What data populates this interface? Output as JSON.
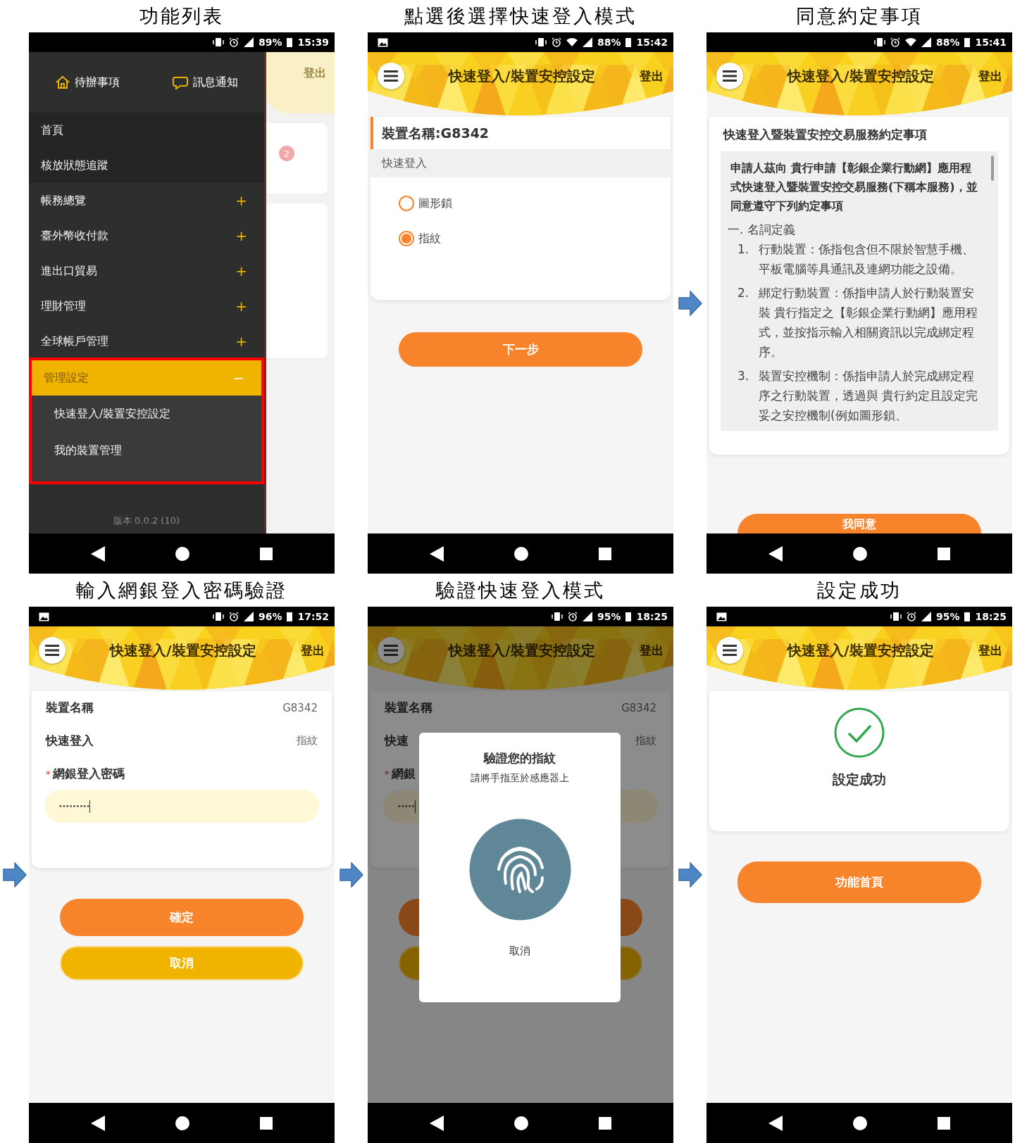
{
  "screens": [
    {
      "kind": "menu",
      "caption": "功能列表",
      "status_bar": {
        "image_icon": false,
        "wifi": false,
        "battery": "89%",
        "time": "15:39"
      },
      "shortcuts": [
        {
          "label": "待辦事項"
        },
        {
          "label": "訊息通知"
        }
      ],
      "items": [
        {
          "label": "首頁",
          "expanded": false,
          "highlighted": false
        },
        {
          "label": "核放狀態追蹤",
          "expanded": false,
          "highlighted": false
        },
        {
          "label": "帳務總覽",
          "toggle": "+",
          "expanded": false,
          "highlighted": false
        },
        {
          "label": "臺外幣收付款",
          "toggle": "+",
          "expanded": false,
          "highlighted": false
        },
        {
          "label": "進出口貿易",
          "toggle": "+",
          "expanded": false,
          "highlighted": false
        },
        {
          "label": "理財管理",
          "toggle": "+",
          "expanded": false,
          "highlighted": false
        },
        {
          "label": "全球帳戶管理",
          "toggle": "+",
          "expanded": false,
          "highlighted": false
        },
        {
          "label": "管理設定",
          "toggle": "−",
          "expanded": true,
          "highlighted": true,
          "children": [
            {
              "label": "快速登入/裝置安控設定"
            },
            {
              "label": "我的裝置管理"
            }
          ]
        }
      ],
      "version": "版本 0.0.2 (10)",
      "behind": {
        "logout": "登出",
        "badge": "2"
      }
    },
    {
      "kind": "options",
      "caption": "點選後選擇快速登入模式",
      "status_bar": {
        "image_icon": true,
        "wifi": true,
        "battery": "88%",
        "time": "15:42"
      },
      "app_bar": {
        "title": "快速登入/裝置安控設定",
        "logout": "登出"
      },
      "device_label": "裝置名稱:G8342",
      "section": "快速登入",
      "options": [
        {
          "label": "圖形鎖",
          "selected": false
        },
        {
          "label": "指紋",
          "selected": true
        }
      ],
      "button": "下一步"
    },
    {
      "kind": "terms",
      "caption": "同意約定事項",
      "status_bar": {
        "image_icon": false,
        "wifi": true,
        "battery": "88%",
        "time": "15:41"
      },
      "app_bar": {
        "title": "快速登入/裝置安控設定",
        "logout": "登出"
      },
      "heading": "快速登入暨裝置安控交易服務約定事項",
      "intro": "申請人茲向 貴行申請【彰銀企業行動網】應用程式快速登入暨裝置安控交易服務(下稱本服務)，並同意遵守下列約定事項",
      "section": "一. 名詞定義",
      "clauses": [
        {
          "number": "1.",
          "text": "行動裝置：係指包含但不限於智慧手機、平板電腦等具通訊及連網功能之設備。"
        },
        {
          "number": "2.",
          "text": "綁定行動裝置：係指申請人於行動裝置安裝 貴行指定之【彰銀企業行動網】應用程式，並按指示輸入相關資訊以完成綁定程序。"
        },
        {
          "number": "3.",
          "text": "裝置安控機制：係指申請人於完成綁定程序之行動裝置，透過與 貴行約定且設定完妥之安控機制(例如圖形鎖、"
        }
      ],
      "button": "我同意"
    },
    {
      "kind": "password",
      "caption": "輸入網銀登入密碼驗證",
      "status_bar": {
        "image_icon": true,
        "wifi": false,
        "battery": "96%",
        "time": "17:52"
      },
      "app_bar": {
        "title": "快速登入/裝置安控設定",
        "logout": "登出"
      },
      "fields": [
        {
          "label": "裝置名稱",
          "value": "G8342"
        },
        {
          "label": "快速登入",
          "value": "指紋"
        }
      ],
      "required_mark": "*",
      "password_label": "網銀登入密碼",
      "password_value": "•••••••••",
      "buttons": [
        {
          "label": "確定",
          "kind": "primary"
        },
        {
          "label": "取消",
          "kind": "secondary"
        }
      ]
    },
    {
      "kind": "verify",
      "caption": "驗證快速登入模式",
      "status_bar": {
        "image_icon": false,
        "wifi": false,
        "battery": "95%",
        "time": "18:25"
      },
      "app_bar": {
        "title": "快速登入/裝置安控設定",
        "logout": "登出"
      },
      "fields": [
        {
          "label": "裝置名稱",
          "value": "G8342"
        },
        {
          "label": "快速",
          "value": "指紋"
        }
      ],
      "required_mark": "*",
      "password_label": "網銀",
      "password_value": "•••••",
      "buttons": [
        {
          "kind": "primary"
        },
        {
          "kind": "secondary"
        }
      ],
      "dialog": {
        "title": "驗證您的指紋",
        "message": "請將手指至於感應器上",
        "cancel": "取消"
      }
    },
    {
      "kind": "success",
      "caption": "設定成功",
      "status_bar": {
        "image_icon": true,
        "wifi": false,
        "battery": "95%",
        "time": "18:25"
      },
      "app_bar": {
        "title": "快速登入/裝置安控設定",
        "logout": "登出"
      },
      "message": "設定成功",
      "button": "功能首頁"
    }
  ]
}
